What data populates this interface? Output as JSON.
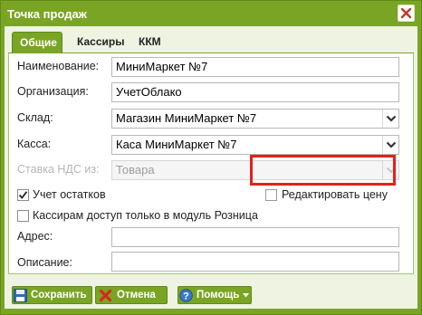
{
  "window": {
    "title": "Точка продаж"
  },
  "tabs": [
    {
      "label": "Общие",
      "active": true
    },
    {
      "label": "Кассиры",
      "active": false
    },
    {
      "label": "ККМ",
      "active": false
    }
  ],
  "form": {
    "name_label": "Наименование:",
    "name_value": "МиниМаркет №7",
    "org_label": "Организация:",
    "org_value": "УчетОблако",
    "warehouse_label": "Склад:",
    "warehouse_value": "Магазин МиниМаркет №7",
    "cashdesk_label": "Касса:",
    "cashdesk_value": "Каса МиниМаркет №7",
    "vat_label": "Ставка НДС из:",
    "vat_value": "Товара",
    "stock_tracking_label": "Учет остатков",
    "stock_tracking_checked": true,
    "edit_price_label": "Редактировать цену",
    "edit_price_checked": false,
    "retail_only_label": "Кассирам доступ только в модуль Розница",
    "retail_only_checked": false,
    "address_label": "Адрес:",
    "address_value": "",
    "description_label": "Описание:",
    "description_value": ""
  },
  "buttons": {
    "save": "Сохранить",
    "cancel": "Отмена",
    "help": "Помощь"
  },
  "colors": {
    "frame": "#7aa524",
    "body": "#eef3e2",
    "highlight": "#e2211c"
  }
}
